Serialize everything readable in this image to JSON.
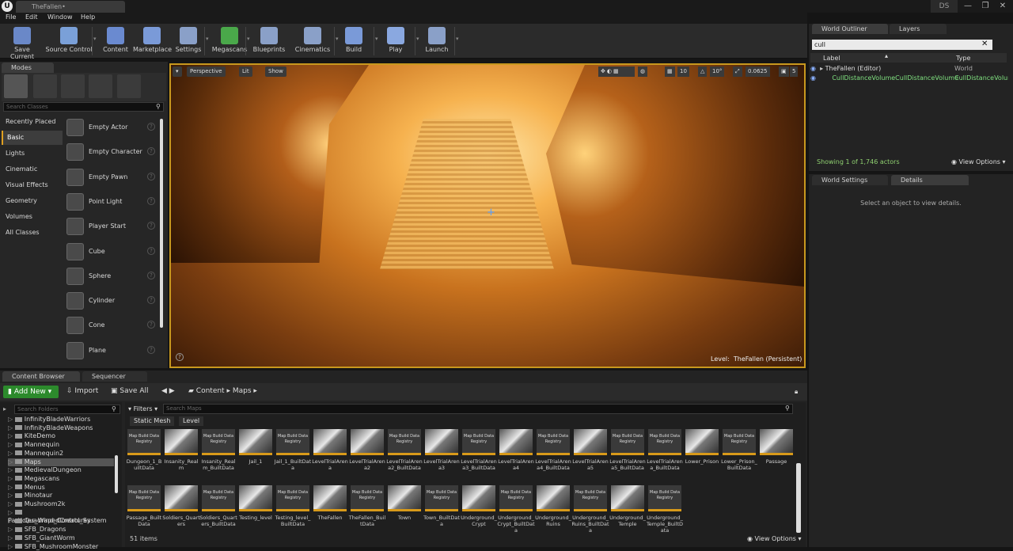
{
  "window": {
    "tab_title": "TheFallen•",
    "profile": "DS",
    "minimize": "—",
    "restore": "❐",
    "close": "✕"
  },
  "menu": [
    "File",
    "Edit",
    "Window",
    "Help"
  ],
  "toolbar": [
    {
      "label": "Save Current",
      "icon": "save-icon",
      "color": "#6a88c8"
    },
    {
      "label": "Source Control",
      "icon": "source-control-icon",
      "color": "#7aa0d8"
    },
    {
      "label": "Content",
      "icon": "content-icon",
      "color": "#6a8ad0"
    },
    {
      "label": "Marketplace",
      "icon": "marketplace-icon",
      "color": "#7a9ad8"
    },
    {
      "label": "Settings",
      "icon": "settings-icon",
      "color": "#8aa0c8"
    },
    {
      "label": "Megascans",
      "icon": "megascans-icon",
      "color": "#4aa84a"
    },
    {
      "label": "Blueprints",
      "icon": "blueprints-icon",
      "color": "#8aa0c8"
    },
    {
      "label": "Cinematics",
      "icon": "cinematics-icon",
      "color": "#8aa0c8"
    },
    {
      "label": "Build",
      "icon": "build-icon",
      "color": "#7a9ad8"
    },
    {
      "label": "Play",
      "icon": "play-icon",
      "color": "#8aa8e0"
    },
    {
      "label": "Launch",
      "icon": "launch-icon",
      "color": "#8aa0c8"
    }
  ],
  "modes": {
    "tab": "Modes",
    "search_placeholder": "Search Classes",
    "categories": [
      "Recently Placed",
      "Basic",
      "Lights",
      "Cinematic",
      "Visual Effects",
      "Geometry",
      "Volumes",
      "All Classes"
    ],
    "selected_category": "Basic",
    "actors": [
      "Empty Actor",
      "Empty Character",
      "Empty Pawn",
      "Point Light",
      "Player Start",
      "Cube",
      "Sphere",
      "Cylinder",
      "Cone",
      "Plane"
    ]
  },
  "viewport": {
    "perspective": "Perspective",
    "lit": "Lit",
    "show": "Show",
    "grid_snap": "10",
    "rot_snap": "10°",
    "scale_snap": "0.0625",
    "cam_speed": "5",
    "level_label": "Level:",
    "level_name": "TheFallen (Persistent)"
  },
  "outliner": {
    "tab": "World Outliner",
    "tab2": "Layers",
    "search_value": "cull",
    "col_label": "Label",
    "col_type": "Type",
    "rows": [
      {
        "label": "TheFallen (Editor)",
        "type": "World"
      },
      {
        "label": "CullDistanceVolumeCullDistanceVolume",
        "type": "CullDistanceVolume"
      }
    ],
    "showing": "Showing 1 of 1,746 actors",
    "view_options": "View Options"
  },
  "details": {
    "tab": "World Settings",
    "tab2": "Details",
    "empty_msg": "Select an object to view details."
  },
  "content_browser": {
    "tab": "Content Browser",
    "tab2": "Sequencer",
    "add_new": "Add New",
    "import": "Import",
    "save_all": "Save All",
    "path": [
      "Content",
      "Maps"
    ],
    "search_folders_placeholder": "Search Folders",
    "folders": [
      "InfinityBladeWarriors",
      "InfinityBladeWeapons",
      "KiteDemo",
      "Mannequin",
      "Mannequin2",
      "Maps",
      "MedievalDungeon",
      "Megascans",
      "Menus",
      "Minotaur",
      "Mushroom2k",
      "Particles_Wind_Control_System",
      "QuadrapedCreatures",
      "SFB_Dragons",
      "SFB_GiantWorm",
      "SFB_MushroomMonster"
    ],
    "selected_folder": "Maps",
    "filters": "Filters",
    "search_maps_placeholder": "Search Maps",
    "filter_pills": [
      "Static Mesh",
      "Level"
    ],
    "assets": [
      {
        "name": "Dungeon_1_BuiltData",
        "kind": "data"
      },
      {
        "name": "Insanity_Realm",
        "kind": "map"
      },
      {
        "name": "Insanity_Realm_BuiltData",
        "kind": "data"
      },
      {
        "name": "Jail_1",
        "kind": "map"
      },
      {
        "name": "Jail_1_BuiltData",
        "kind": "data"
      },
      {
        "name": "LevelTrialArena",
        "kind": "map"
      },
      {
        "name": "LevelTrialArena2",
        "kind": "map"
      },
      {
        "name": "LevelTrialArena2_BuiltData",
        "kind": "data"
      },
      {
        "name": "LevelTrialArena3",
        "kind": "map"
      },
      {
        "name": "LevelTrialArena3_BuiltData",
        "kind": "data"
      },
      {
        "name": "LevelTrialArena4",
        "kind": "map"
      },
      {
        "name": "LevelTrialArena4_BuiltData",
        "kind": "data"
      },
      {
        "name": "LevelTrialArena5",
        "kind": "map"
      },
      {
        "name": "LevelTrialArena5_BuiltData",
        "kind": "data"
      },
      {
        "name": "LevelTrialArena_BuiltData",
        "kind": "data"
      },
      {
        "name": "Lower_Prison",
        "kind": "map"
      },
      {
        "name": "Lower_Prison_BuiltData",
        "kind": "data"
      },
      {
        "name": "Passage",
        "kind": "map"
      },
      {
        "name": "Passage_BuiltData",
        "kind": "data"
      },
      {
        "name": "Soldiers_Quarters",
        "kind": "map"
      },
      {
        "name": "Soldiers_Quarters_BuiltData",
        "kind": "data"
      },
      {
        "name": "Testing_level",
        "kind": "map"
      },
      {
        "name": "Testing_level_BuiltData",
        "kind": "data"
      },
      {
        "name": "TheFallen",
        "kind": "map"
      },
      {
        "name": "TheFallen_BuiltData",
        "kind": "data"
      },
      {
        "name": "Town",
        "kind": "map"
      },
      {
        "name": "Town_BuiltData",
        "kind": "data"
      },
      {
        "name": "Underground_Crypt",
        "kind": "map"
      },
      {
        "name": "Underground_Crypt_BuiltData",
        "kind": "data"
      },
      {
        "name": "Underground_Ruins",
        "kind": "map"
      },
      {
        "name": "Underground_Ruins_BuiltData",
        "kind": "data"
      },
      {
        "name": "Underground_Temple",
        "kind": "map"
      },
      {
        "name": "Underground_Temple_BuiltData",
        "kind": "data"
      }
    ],
    "data_thumb_text": "Map Build Data Registry",
    "items_count": "51 items",
    "view_options": "View Options"
  }
}
